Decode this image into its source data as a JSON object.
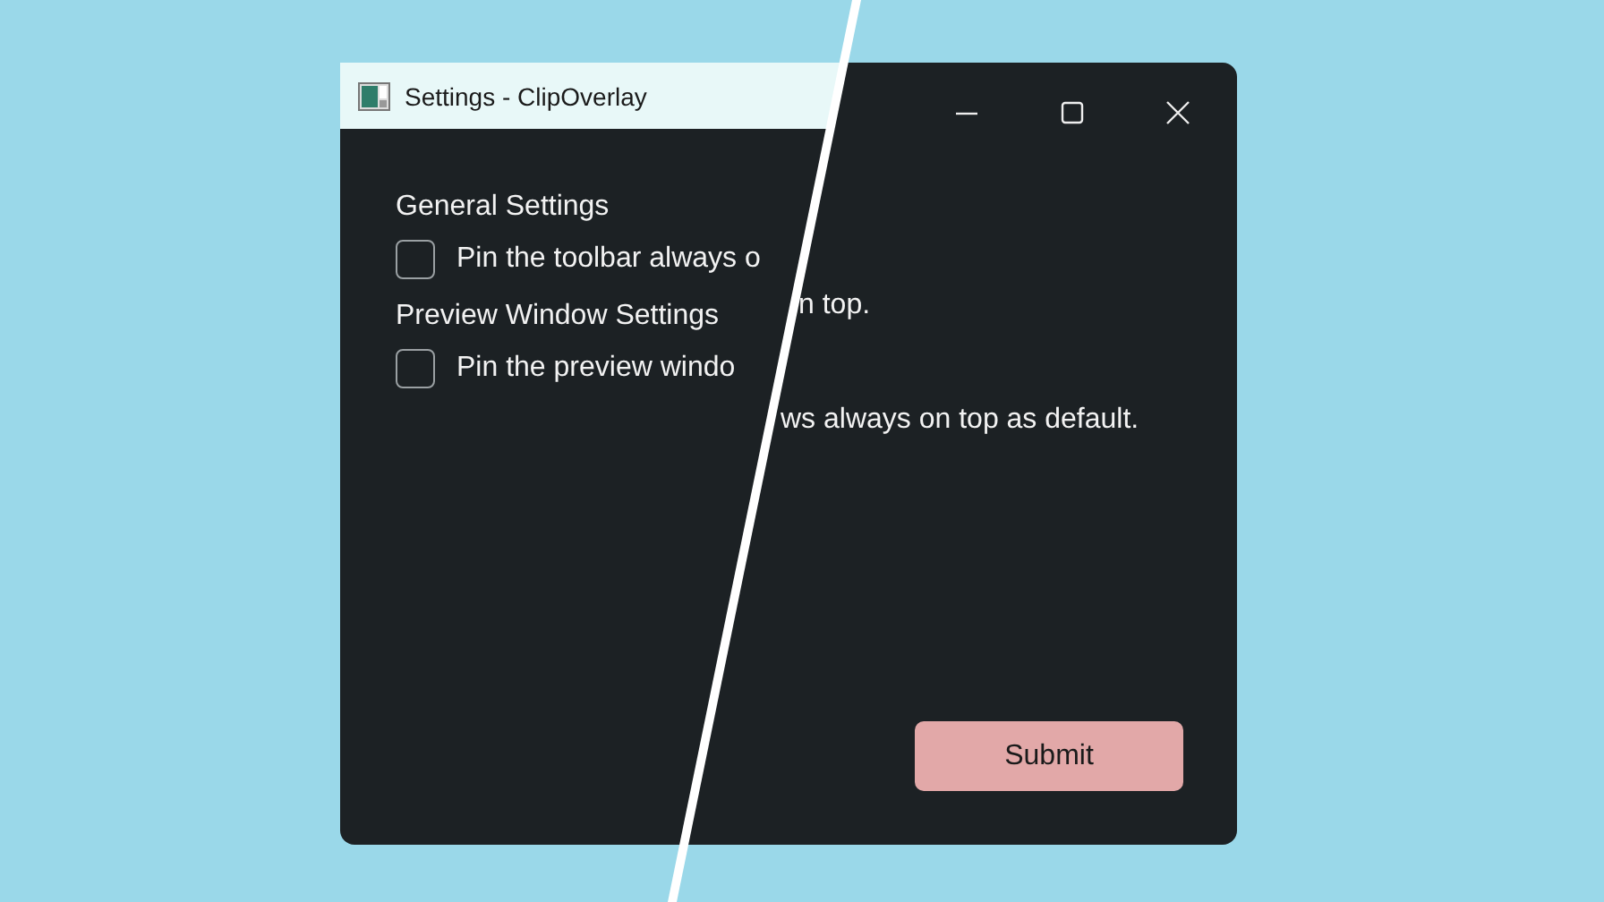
{
  "left_pane": {
    "title_bar": {
      "title": "Settings - ClipOverlay"
    },
    "sections": [
      {
        "heading": "General Settings",
        "checkbox": {
          "label": "Pin the toolbar always o",
          "checked": false
        }
      },
      {
        "heading": "Preview Window Settings",
        "checkbox": {
          "label": "Pin the preview windo",
          "checked": false
        }
      }
    ]
  },
  "right_pane": {
    "label_fragments": [
      "n top.",
      "ws always on top as default."
    ],
    "submit_button": "Submit"
  }
}
